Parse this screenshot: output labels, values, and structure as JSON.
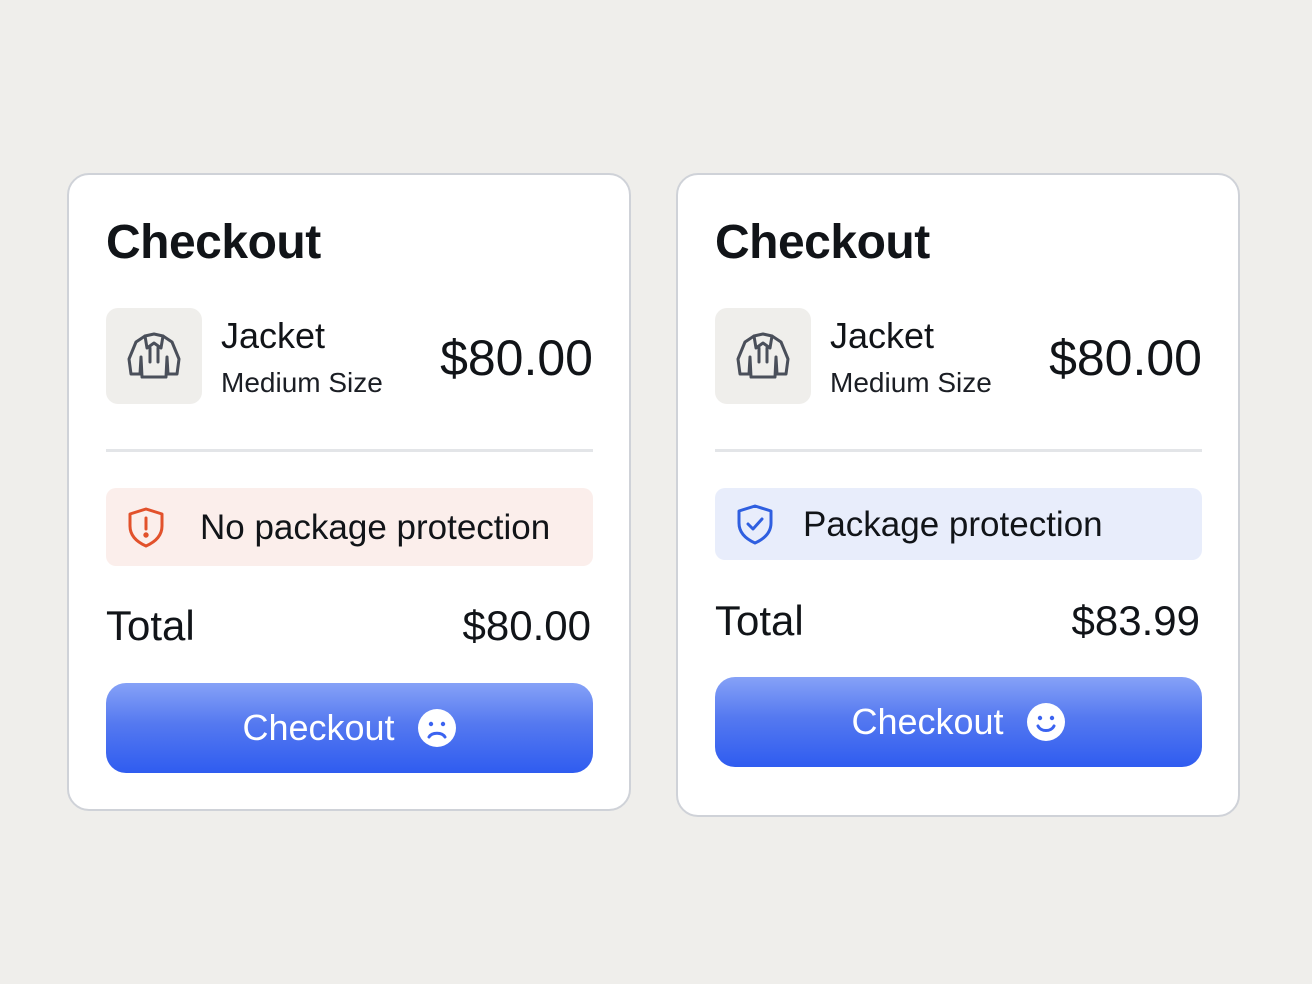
{
  "cards": [
    {
      "title": "Checkout",
      "item": {
        "icon": "jacket-icon",
        "name": "Jacket",
        "variant": "Medium Size",
        "price": "$80.00"
      },
      "protection": {
        "icon": "shield-alert-icon",
        "label": "No package protection",
        "color": "#e2512b",
        "background": "#fbeeeb"
      },
      "total": {
        "label": "Total",
        "value": "$80.00"
      },
      "button": {
        "label": "Checkout",
        "icon": "sad-face-icon"
      }
    },
    {
      "title": "Checkout",
      "item": {
        "icon": "jacket-icon",
        "name": "Jacket",
        "variant": "Medium Size",
        "price": "$80.00"
      },
      "protection": {
        "icon": "shield-check-icon",
        "label": "Package protection",
        "color": "#2f5fe0",
        "background": "#e8edfb"
      },
      "total": {
        "label": "Total",
        "value": "$83.99"
      },
      "button": {
        "label": "Checkout",
        "icon": "smile-face-icon"
      }
    }
  ],
  "colors": {
    "accent": "#2f5cf0",
    "background": "#efeeeb",
    "card_border": "#cfd2d8"
  }
}
